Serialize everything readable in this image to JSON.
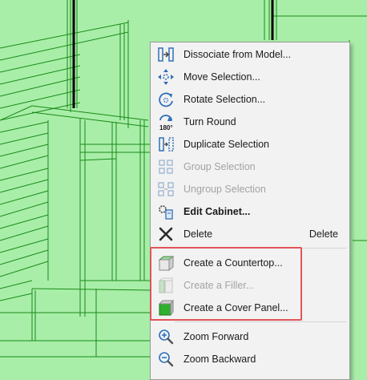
{
  "colors": {
    "viewport_bg": "#a8eea8",
    "wireframe": "#1a8a1a",
    "menu_bg": "#f2f2f2",
    "highlight_border": "#e05558",
    "icon_blue": "#2f6fb8",
    "disabled_text": "#a3a3a3"
  },
  "menu": {
    "items": [
      {
        "label": "Dissociate from Model...",
        "icon": "dissociate-icon"
      },
      {
        "label": "Move Selection...",
        "icon": "move-icon"
      },
      {
        "label": "Rotate Selection...",
        "icon": "rotate-icon"
      },
      {
        "label": "Turn Round",
        "icon": "turn-180-icon",
        "icon_text": "180°"
      },
      {
        "label": "Duplicate Selection",
        "icon": "duplicate-icon"
      },
      {
        "label": "Group Selection",
        "icon": "group-icon",
        "disabled": true
      },
      {
        "label": "Ungroup Selection",
        "icon": "ungroup-icon",
        "disabled": true
      },
      {
        "label": "Edit Cabinet...",
        "icon": "edit-cabinet-icon",
        "bold": true
      },
      {
        "label": "Delete",
        "icon": "delete-x-icon",
        "shortcut": "Delete"
      },
      {
        "label": "Create a Countertop...",
        "icon": "countertop-icon"
      },
      {
        "label": "Create a Filler...",
        "icon": "filler-icon",
        "disabled": true
      },
      {
        "label": "Create a Cover Panel...",
        "icon": "cover-panel-icon"
      },
      {
        "label": "Zoom Forward",
        "icon": "zoom-in-icon"
      },
      {
        "label": "Zoom Backward",
        "icon": "zoom-out-icon"
      }
    ]
  }
}
